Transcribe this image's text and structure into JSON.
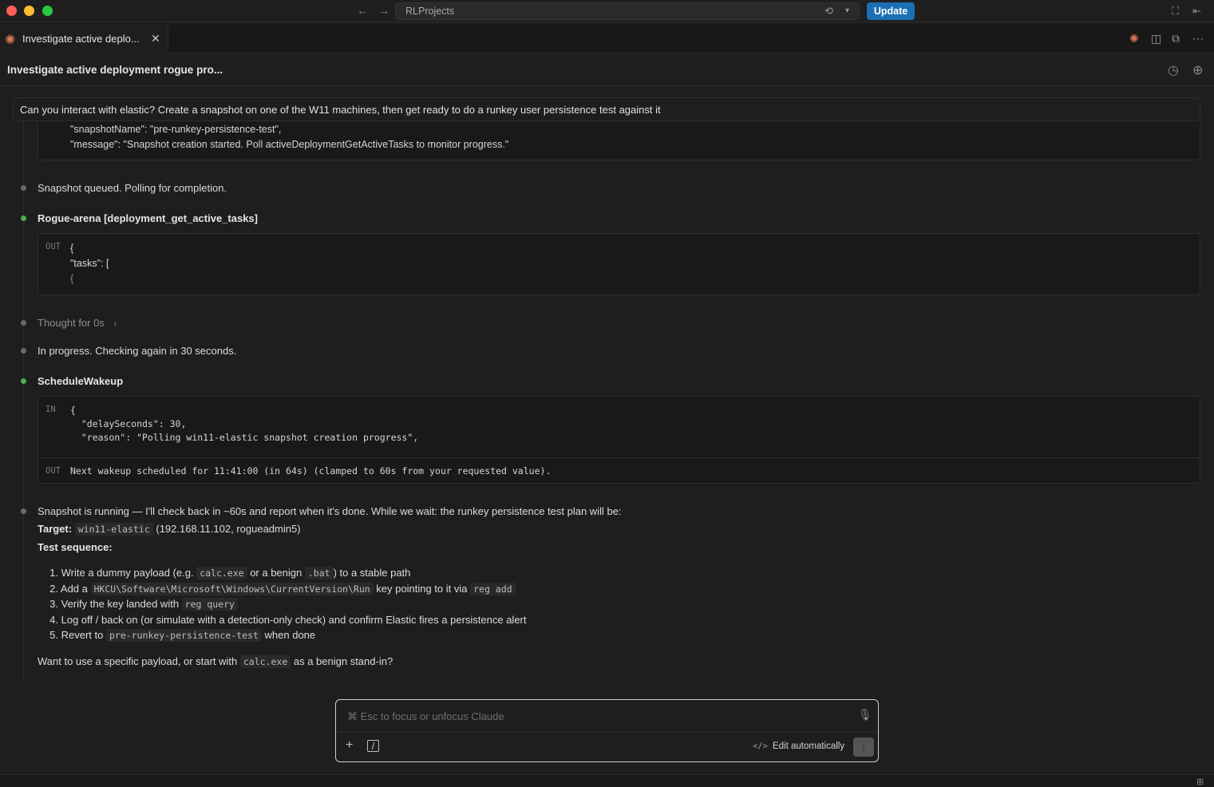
{
  "window": {
    "address": "RLProjects",
    "update_label": "Update"
  },
  "tab": {
    "title": "Investigate active deplo...",
    "close": "✕"
  },
  "header": {
    "title": "Investigate active deployment rogue pro..."
  },
  "prompt": {
    "text": "Can you interact with elastic? Create a snapshot on one of the W11 machines, then get ready to do a runkey user persistence test against it"
  },
  "conversation": {
    "top_block": {
      "line1": "\"snapshotName\": \"pre-runkey-persistence-test\",",
      "line2": "\"message\": \"Snapshot creation started. Poll activeDeploymentGetActiveTasks to monitor progress.\""
    },
    "msg_queued": "Snapshot queued. Polling for completion.",
    "tool1": {
      "title": "Rogue-arena [deployment_get_active_tasks]",
      "tag": "OUT",
      "lines": [
        "{",
        "\"tasks\": [",
        "{"
      ]
    },
    "thought": "Thought for 0s",
    "msg_progress": "In progress. Checking again in 30 seconds.",
    "tool2": {
      "title": "ScheduleWakeup",
      "in_tag": "IN",
      "in_lines": [
        "{",
        "  \"delaySeconds\": 30,",
        "  \"reason\": \"Polling win11-elastic snapshot creation progress\","
      ],
      "out_tag": "OUT",
      "out_text": "Next wakeup scheduled for 11:41:00 (in 64s) (clamped to 60s from your requested value)."
    },
    "plan": {
      "intro": "Snapshot is running — I'll check back in ~60s and report when it's done. While we wait: the runkey persistence test plan will be:",
      "target_label": "Target:",
      "target_host": "win11-elastic",
      "target_rest": " (192.168.11.102, rogueadmin5)",
      "sequence_label": "Test sequence:",
      "steps": [
        {
          "num": "1.",
          "a": "Write a dummy payload (e.g. ",
          "c1": "calc.exe",
          "b": " or a benign ",
          "c2": ".bat",
          "d": ") to a stable path"
        },
        {
          "num": "2.",
          "a": "Add a ",
          "c1": "HKCU\\Software\\Microsoft\\Windows\\CurrentVersion\\Run",
          "b": " key pointing to it via ",
          "c2": "reg add"
        },
        {
          "num": "3.",
          "a": "Verify the key landed with ",
          "c1": "reg query"
        },
        {
          "num": "4.",
          "a": "Log off / back on (or simulate with a detection-only check) and confirm Elastic fires a persistence alert"
        },
        {
          "num": "5.",
          "a": "Revert to ",
          "c1": "pre-runkey-persistence-test",
          "b": " when done"
        }
      ],
      "question_a": "Want to use a specific payload, or start with ",
      "question_code": "calc.exe",
      "question_b": " as a benign stand-in?"
    }
  },
  "composer": {
    "placeholder": "⌘ Esc to focus or unfocus Claude",
    "edit_label": "Edit automatically",
    "edit_icon": "</>"
  }
}
